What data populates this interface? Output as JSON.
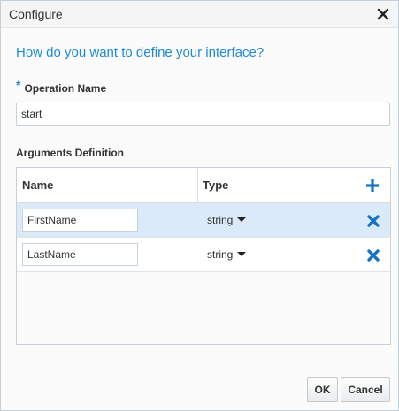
{
  "dialog": {
    "title": "Configure",
    "question": "How do you want to define your interface?"
  },
  "operation": {
    "required_marker": "*",
    "label": "Operation Name",
    "value": "start"
  },
  "arguments": {
    "label": "Arguments Definition",
    "columns": [
      "Name",
      "Type"
    ],
    "rows": [
      {
        "name": "FirstName",
        "type": "string",
        "selected": true
      },
      {
        "name": "LastName",
        "type": "string",
        "selected": false
      }
    ]
  },
  "buttons": {
    "ok": "OK",
    "cancel": "Cancel"
  },
  "colors": {
    "accent": "#1e8ad6",
    "selected_row": "#dbeaf9",
    "icon_blue": "#1573c3"
  },
  "icons": {
    "close": "close-icon",
    "add": "plus-icon",
    "delete": "delete-x-icon",
    "dropdown": "caret-down-icon"
  }
}
